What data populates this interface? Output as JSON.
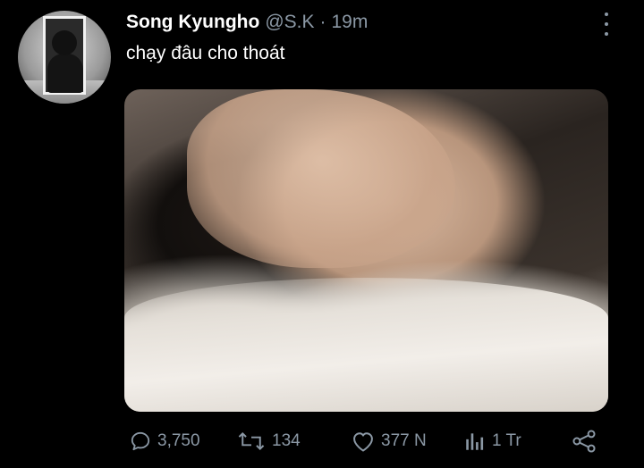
{
  "tweet": {
    "display_name": "Song Kyungho",
    "handle": "@S.K",
    "separator": "·",
    "time": "19m",
    "text": "chạy đâu cho thoát"
  },
  "actions": {
    "replies": "3,750",
    "retweets": "134",
    "likes": "377 N",
    "views": "1 Tr"
  },
  "icons": {
    "reply": "speech-bubble-icon",
    "retweet": "retweet-arrows-icon",
    "like": "heart-icon",
    "views": "bar-chart-icon",
    "share": "share-icon",
    "more": "more-vertical-icon"
  },
  "colors": {
    "background": "#000000",
    "primary_text": "#ffffff",
    "secondary_text": "#8b98a5"
  }
}
